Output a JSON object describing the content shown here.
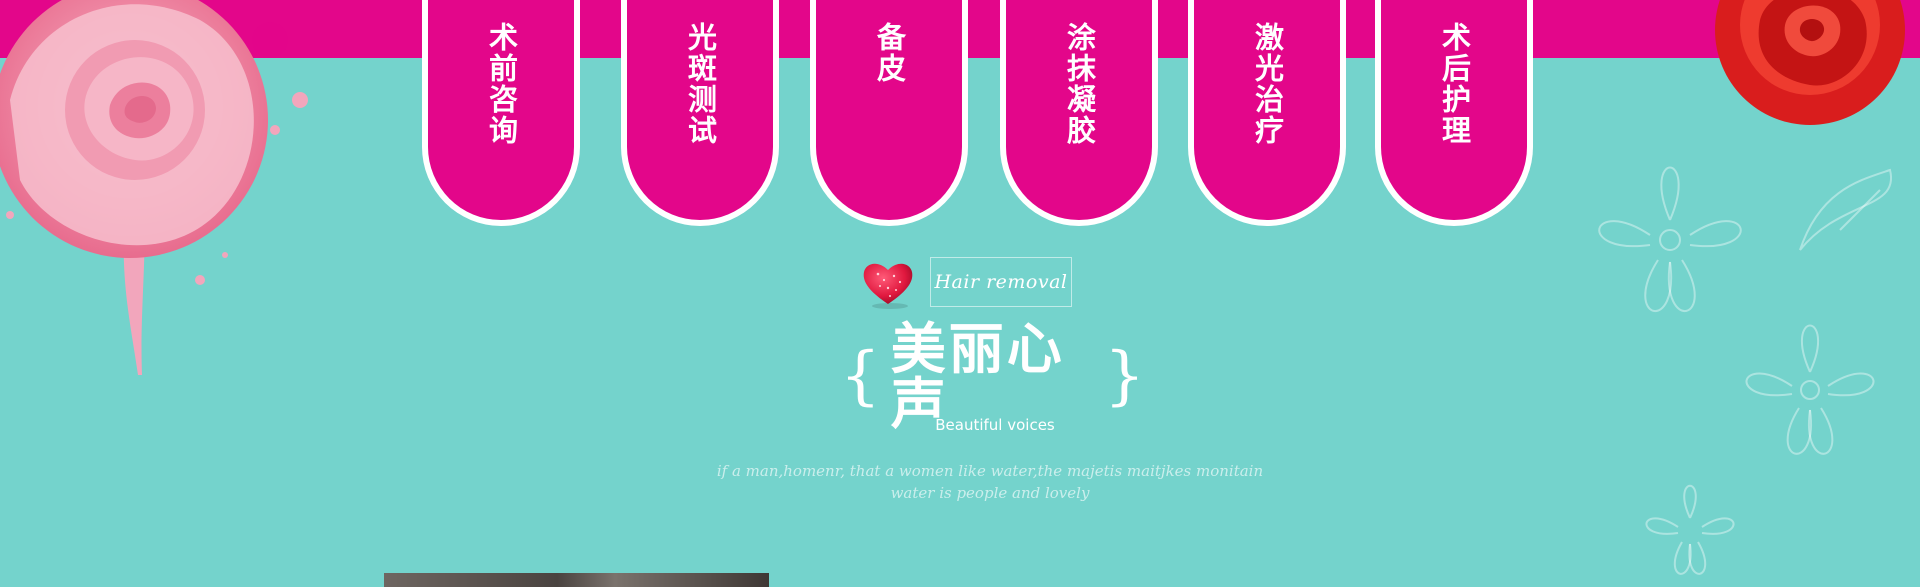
{
  "steps": [
    {
      "label": "术前咨询"
    },
    {
      "label": "光斑测试"
    },
    {
      "label": "备皮"
    },
    {
      "label": "涂抹凝胶"
    },
    {
      "label": "激光治疗"
    },
    {
      "label": "术后护理"
    }
  ],
  "section": {
    "badge_text": "Hair removal",
    "title": "美丽心声",
    "brace_open": "{",
    "brace_close": "}",
    "subtitle": "Beautiful voices",
    "tagline_line1": "if a man,homenr, that a women like water,the majetis maitjkes monitain",
    "tagline_line2": "water is people and lovely"
  },
  "colors": {
    "background": "#74d3cc",
    "accent_magenta": "#e3068a",
    "text_white": "#ffffff"
  },
  "icons": [
    "pink-rose",
    "red-rose",
    "heart",
    "flower-outline"
  ]
}
